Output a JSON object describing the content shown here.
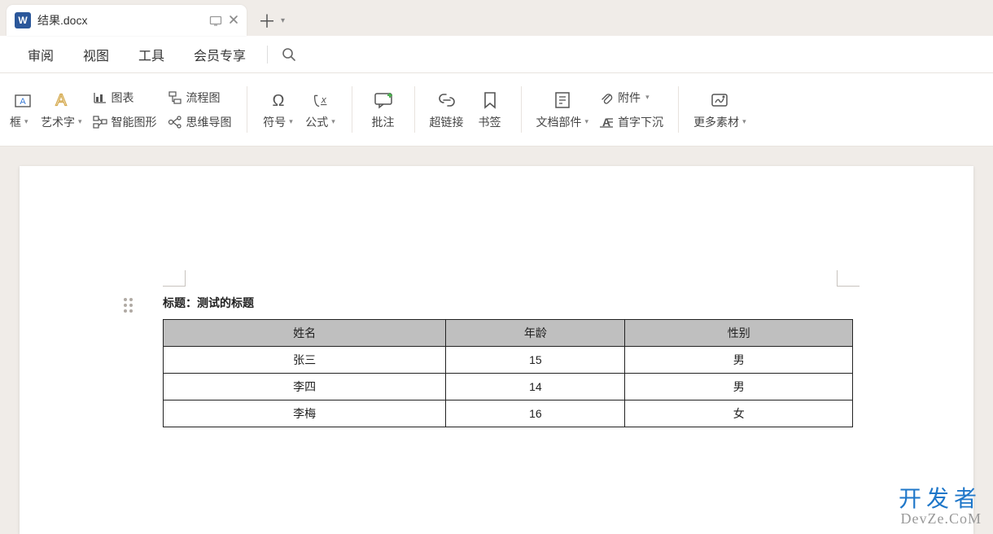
{
  "tab": {
    "filename": "结果.docx",
    "word_letter": "W"
  },
  "menu": [
    "审阅",
    "视图",
    "工具",
    "会员专享"
  ],
  "ribbon": {
    "textbox_label": "框",
    "wordart_label": "艺术字",
    "chart_label": "图表",
    "smartart_label": "智能图形",
    "flowchart_label": "流程图",
    "mindmap_label": "思维导图",
    "symbol_label": "符号",
    "formula_label": "公式",
    "comment_label": "批注",
    "hyperlink_label": "超链接",
    "bookmark_label": "书签",
    "docpart_label": "文档部件",
    "attachment_label": "附件",
    "dropcap_label": "首字下沉",
    "more_label": "更多素材"
  },
  "document": {
    "title_prefix": "标题：",
    "title_value": "测试的标题",
    "headers": [
      "姓名",
      "年龄",
      "性别"
    ],
    "rows": [
      [
        "张三",
        "15",
        "男"
      ],
      [
        "李四",
        "14",
        "男"
      ],
      [
        "李梅",
        "16",
        "女"
      ]
    ]
  },
  "watermark": {
    "line1": "开发者",
    "line2": "DevZe.CoM"
  }
}
